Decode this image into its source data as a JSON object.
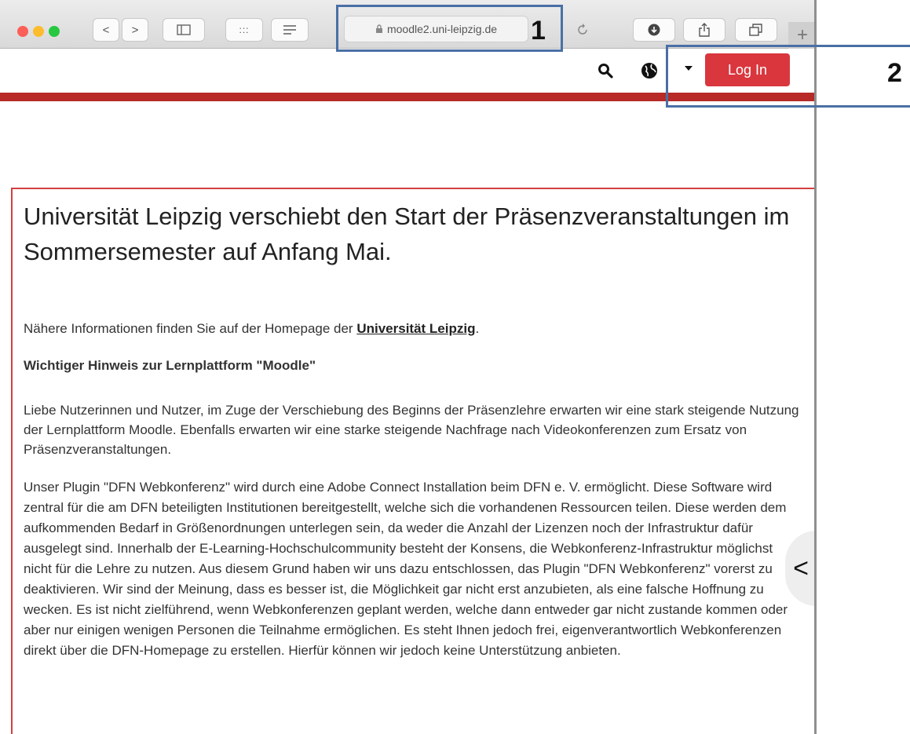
{
  "browser": {
    "url": "moodle2.uni-leipzig.de",
    "nav_prev": "<",
    "nav_next": ">",
    "grid_glyph": ":::",
    "add_tab": "+"
  },
  "header": {
    "login_label": "Log In"
  },
  "annotations": {
    "box1_label": "1",
    "box2_label": "2"
  },
  "article": {
    "title": "Universität Leipzig verschiebt den Start der Präsenzveranstaltungen im Sommersemester auf Anfang Mai.",
    "info_prefix": "Nähere Informationen finden Sie auf der Homepage der ",
    "info_link": "Universität Leipzig",
    "info_suffix": ".",
    "notice_heading": "Wichtiger Hinweis zur Lernplattform \"Moodle\"",
    "para1": "Liebe Nutzerinnen und Nutzer, im Zuge der Verschiebung des Beginns der Präsenzlehre erwarten wir eine stark steigende Nutzung der Lernplattform Moodle. Ebenfalls erwarten wir eine starke steigende Nachfrage nach Videokonferenzen zum Ersatz von Präsenzveranstaltungen.",
    "para2": "Unser Plugin \"DFN Webkonferenz\" wird durch eine Adobe Connect Installation beim DFN e. V. ermöglicht. Diese Software wird zentral für die am DFN beteiligten Institutionen bereitgestellt, welche sich die vorhandenen Ressourcen teilen. Diese werden dem aufkommenden Bedarf in Größenordnungen unterlegen sein, da weder die Anzahl der Lizenzen noch der Infrastruktur dafür ausgelegt sind. Innerhalb der E-Learning-Hochschulcommunity besteht der Konsens, die Webkonferenz-Infrastruktur möglichst nicht für die Lehre zu nutzen. Aus diesem Grund haben wir uns dazu entschlossen, das Plugin \"DFN Webkonferenz\" vorerst zu deaktivieren. Wir sind der Meinung, dass es besser ist, die Möglichkeit gar nicht erst anzubieten, als eine falsche Hoffnung zu wecken. Es ist nicht zielführend, wenn Webkonferenzen geplant werden, welche dann entweder gar nicht zustande kommen oder aber nur einigen wenigen Personen die Teilnahme ermöglichen. Es steht Ihnen jedoch frei, eigenverantwortlich Webkonferenzen direkt über die DFN-Homepage zu erstellen. Hierfür können wir jedoch keine Unterstützung anbieten."
  },
  "drawer": {
    "glyph": "<"
  },
  "colors": {
    "brand_red": "#b72a28",
    "login_red": "#d9363e",
    "annotation_blue": "#4a6fa5"
  }
}
